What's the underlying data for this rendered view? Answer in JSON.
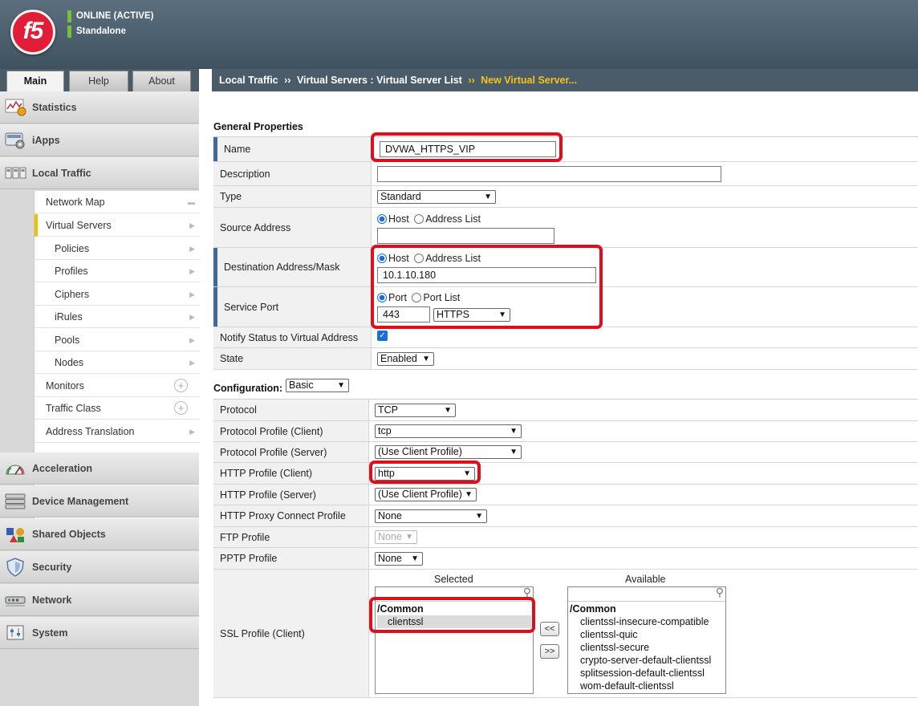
{
  "header": {
    "logo_text": "f5",
    "status_line1": "ONLINE (ACTIVE)",
    "status_line2": "Standalone"
  },
  "tabs": [
    "Main",
    "Help",
    "About"
  ],
  "sidebar": {
    "sections": [
      "Statistics",
      "iApps",
      "Local Traffic",
      "Acceleration",
      "Device Management",
      "Shared Objects",
      "Security",
      "Network",
      "System"
    ],
    "local_traffic_items": [
      "Network Map",
      "Virtual Servers",
      "Policies",
      "Profiles",
      "Ciphers",
      "iRules",
      "Pools",
      "Nodes",
      "Monitors",
      "Traffic Class",
      "Address Translation"
    ]
  },
  "breadcrumb": {
    "part1": "Local Traffic",
    "sep": "››",
    "part2": "Virtual Servers : Virtual Server List",
    "current": "New Virtual Server..."
  },
  "general": {
    "title": "General Properties",
    "name_label": "Name",
    "name_value": "DVWA_HTTPS_VIP",
    "description_label": "Description",
    "description_value": "",
    "type_label": "Type",
    "type_value": "Standard",
    "source_label": "Source Address",
    "opt_host": "Host",
    "opt_address_list": "Address List",
    "source_value": "",
    "dest_label": "Destination Address/Mask",
    "dest_value": "10.1.10.180",
    "port_label": "Service Port",
    "opt_port": "Port",
    "opt_port_list": "Port List",
    "port_value": "443",
    "port_service": "HTTPS",
    "notify_label": "Notify Status to Virtual Address",
    "state_label": "State",
    "state_value": "Enabled"
  },
  "configuration": {
    "title": "Configuration:",
    "mode": "Basic",
    "protocol_label": "Protocol",
    "protocol_value": "TCP",
    "pp_client_label": "Protocol Profile (Client)",
    "pp_client_value": "tcp",
    "pp_server_label": "Protocol Profile (Server)",
    "pp_server_value": "(Use Client Profile)",
    "http_client_label": "HTTP Profile (Client)",
    "http_client_value": "http",
    "http_server_label": "HTTP Profile (Server)",
    "http_server_value": "(Use Client Profile)",
    "proxy_label": "HTTP Proxy Connect Profile",
    "proxy_value": "None",
    "ftp_label": "FTP Profile",
    "ftp_value": "None",
    "pptp_label": "PPTP Profile",
    "pptp_value": "None",
    "ssl_client_label": "SSL Profile (Client)",
    "selected_header": "Selected",
    "available_header": "Available",
    "folder": "/Common",
    "selected_items": [
      "clientssl"
    ],
    "available_items": [
      "clientssl-insecure-compatible",
      "clientssl-quic",
      "clientssl-secure",
      "crypto-server-default-clientssl",
      "splitsession-default-clientssl",
      "wom-default-clientssl"
    ],
    "btn_add": "<<",
    "btn_remove": ">>"
  },
  "colors": {
    "accent_red": "#e00d1a",
    "header_bg": "#4a5c69",
    "crumb_current": "#f5c21b",
    "required_marker": "#3d6b9c"
  }
}
